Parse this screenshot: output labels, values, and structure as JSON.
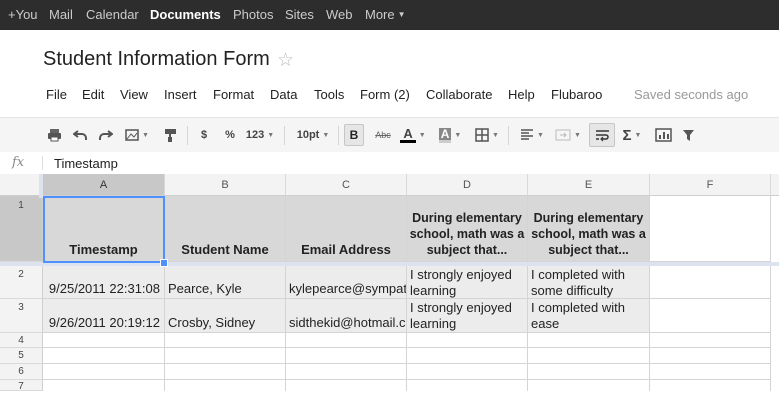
{
  "gbar": {
    "links": [
      "+You",
      "Mail",
      "Calendar",
      "Documents",
      "Photos",
      "Sites",
      "Web",
      "More"
    ],
    "active": "Documents"
  },
  "doc": {
    "title": "Student Information Form",
    "saved": "Saved seconds ago"
  },
  "menu": [
    "File",
    "Edit",
    "View",
    "Insert",
    "Format",
    "Data",
    "Tools",
    "Form (2)",
    "Collaborate",
    "Help",
    "Flubaroo"
  ],
  "toolbar": {
    "currency": "$",
    "percent": "%",
    "number_format": "123",
    "font_size": "10pt",
    "bold": "B",
    "strikethrough": "Abc",
    "text_color": "A",
    "fill_color": "A",
    "sum": "Σ"
  },
  "formula": {
    "fx": "fx",
    "value": "Timestamp"
  },
  "columns": [
    "A",
    "B",
    "C",
    "D",
    "E",
    "F"
  ],
  "rows": [
    "1",
    "2",
    "3",
    "4",
    "5",
    "6",
    "7"
  ],
  "headers": [
    "Timestamp",
    "Student Name",
    "Email Address",
    "During elementary school, math was a subject that...",
    "During elementary school, math was a subject that..."
  ],
  "data": [
    [
      "9/25/2011 22:31:08",
      "Pearce, Kyle",
      "kylepearce@sympat",
      "I strongly enjoyed learning",
      "I completed with some difficulty"
    ],
    [
      "9/26/2011 20:19:12",
      "Crosby, Sidney",
      "sidthekid@hotmail.c",
      "I strongly enjoyed learning",
      "I completed with ease"
    ]
  ],
  "colors": {
    "gbar": "#2d2d2d",
    "header_fill": "#d8d8d8",
    "data_fill": "#ececec",
    "selection": "#4d90fe"
  }
}
